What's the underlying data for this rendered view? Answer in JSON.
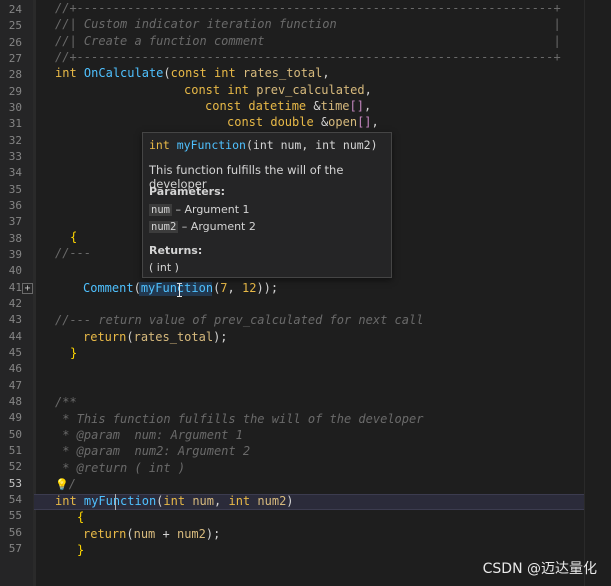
{
  "gutter": {
    "line_numbers": [
      "24",
      "25",
      "26",
      "27",
      "28",
      "29",
      "30",
      "31",
      "32",
      "33",
      "34",
      "35",
      "36",
      "37",
      "38",
      "39",
      "40",
      "41",
      "42",
      "43",
      "44",
      "45",
      "46",
      "47",
      "48",
      "49",
      "50",
      "51",
      "52",
      "53",
      "54",
      "55",
      "56",
      "57"
    ],
    "current_line": "53",
    "fold_symbol": "+"
  },
  "code": {
    "l24": "//+------------------------------------------------------------------+",
    "l25": "//| Custom indicator iteration function                              |",
    "l26": "//| Create a function comment                                        |",
    "l27": "//+------------------------------------------------------------------+",
    "l28_kw": "int",
    "l28_fn": "OnCalculate",
    "l28_p1": "(",
    "l28_kw2": "const int",
    "l28_id": "rates_total",
    "l28_p2": ",",
    "l29_kw": "const int",
    "l29_id": "prev_calculated",
    "l29_p": ",",
    "l30_kw": "const datetime",
    "l30_amp": "&",
    "l30_id": "time",
    "l30_br": "[]",
    "l30_p": ",",
    "l31_kw": "const double",
    "l31_amp": "&",
    "l31_id": "open",
    "l31_br": "[]",
    "l31_p": ",",
    "l37": "{",
    "l38": "//---",
    "l40_fn": "Comment",
    "l40_p1": "(",
    "l40_fn2": "myFunction",
    "l40_p2": "(",
    "l40_n1": "7",
    "l40_p3": ", ",
    "l40_n2": "12",
    "l40_p4": "));",
    "l42": "//--- return value of prev_calculated for next call",
    "l43_kw": "return",
    "l43_p1": "(",
    "l43_id": "rates_total",
    "l43_p2": ");",
    "l44": "}",
    "l47": "/**",
    "l48": " * This function fulfills the will of the developer",
    "l49": " * @param  num: Argument 1",
    "l50": " * @param  num2: Argument 2",
    "l51": " * @return ( int )",
    "l52_bulb": "💡",
    "l52": "/",
    "l53_kw": "int",
    "l53_fn": "myFunction",
    "l53_p1": "(",
    "l53_kw2": "int",
    "l53_id1": "num",
    "l53_p2": ", ",
    "l53_kw3": "int",
    "l53_id2": "num2",
    "l53_p3": ")",
    "l54": "{",
    "l55_kw": "return",
    "l55_p1": "(",
    "l55_id1": "num",
    "l55_op": " + ",
    "l55_id2": "num2",
    "l55_p2": ");",
    "l56": "}"
  },
  "tooltip": {
    "sig_kw": "int",
    "sig_fn": "myFunction",
    "sig_rest": "(int num, int num2)",
    "description": "This function fulfills the will of the developer",
    "params_heading": "Parameters:",
    "param1_name": "num",
    "param1_desc": " – Argument 1",
    "param2_name": "num2",
    "param2_desc": " – Argument 2",
    "returns_heading": "Returns:",
    "returns_value": "( int )"
  },
  "watermark": "CSDN @迈达量化",
  "colors": {
    "keyword": "#e8b947",
    "function": "#4fc1ff",
    "identifier": "#d7ba7d",
    "comment": "#6a6a6a",
    "background": "#1e1e1e"
  }
}
